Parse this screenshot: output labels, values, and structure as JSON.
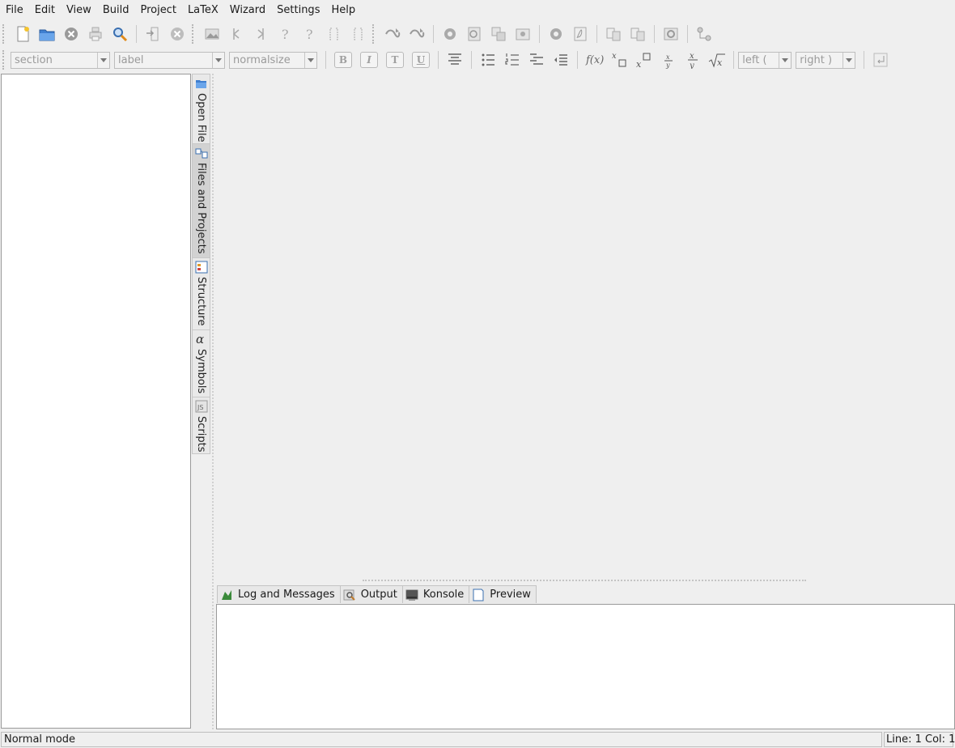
{
  "menu": [
    "File",
    "Edit",
    "View",
    "Build",
    "Project",
    "LaTeX",
    "Wizard",
    "Settings",
    "Help"
  ],
  "format_toolbar": {
    "section_combo": "section",
    "label_combo": "label",
    "size_combo": "normalsize",
    "bold": "B",
    "italic": "I",
    "typewriter": "T",
    "underline": "U",
    "math_function": "f(x)",
    "left_delimiter": "left (",
    "right_delimiter": "right )"
  },
  "side_tabs": [
    "Open File",
    "Files and Projects",
    "Structure",
    "Symbols",
    "Scripts"
  ],
  "bottom_tabs": [
    "Log and Messages",
    "Output",
    "Konsole",
    "Preview"
  ],
  "status": {
    "mode": "Normal mode",
    "position": "Line: 1 Col: 1"
  },
  "colors": {
    "window_bg": "#efefef",
    "panel_bg": "#ffffff",
    "disabled_text": "#9a9a9a"
  }
}
